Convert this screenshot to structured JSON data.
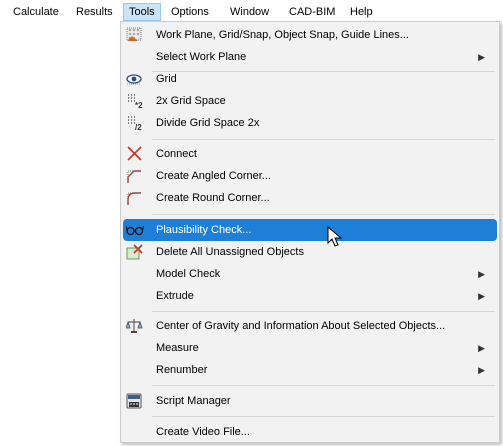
{
  "menubar": {
    "items": [
      {
        "label": "Calculate"
      },
      {
        "label": "Results"
      },
      {
        "label": "Tools"
      },
      {
        "label": "Options"
      },
      {
        "label": "Window"
      },
      {
        "label": "CAD-BIM"
      },
      {
        "label": "Help"
      }
    ],
    "active": "Tools"
  },
  "tools_menu": {
    "items": [
      {
        "label": "Work Plane, Grid/Snap, Object Snap, Guide Lines...",
        "icon": "work-plane-icon"
      },
      {
        "label": "Select Work Plane",
        "submenu": true
      },
      {
        "label": "Grid",
        "icon": "grid-eye-icon"
      },
      {
        "label": "2x Grid Space",
        "icon": "grid-double-icon"
      },
      {
        "label": "Divide Grid Space 2x",
        "icon": "grid-divide-icon"
      },
      {
        "label": "Connect",
        "icon": "connect-icon"
      },
      {
        "label": "Create Angled Corner...",
        "icon": "angled-corner-icon"
      },
      {
        "label": "Create Round Corner...",
        "icon": "round-corner-icon"
      },
      {
        "label": "Plausibility Check...",
        "icon": "glasses-icon",
        "highlighted": true
      },
      {
        "label": "Delete All Unassigned Objects",
        "icon": "delete-objects-icon"
      },
      {
        "label": "Model Check",
        "submenu": true
      },
      {
        "label": "Extrude",
        "submenu": true
      },
      {
        "label": "Center of Gravity and Information About Selected Objects...",
        "icon": "center-of-gravity-icon"
      },
      {
        "label": "Measure",
        "submenu": true
      },
      {
        "label": "Renumber",
        "submenu": true
      },
      {
        "label": "Script Manager",
        "icon": "script-manager-icon"
      },
      {
        "label": "Create Video File..."
      }
    ],
    "submenu_arrow": "▶"
  },
  "colors": {
    "highlight": "#1e7fd8",
    "menu_background": "#f2f2f2",
    "active_menubar_item": "#cce4f7"
  }
}
